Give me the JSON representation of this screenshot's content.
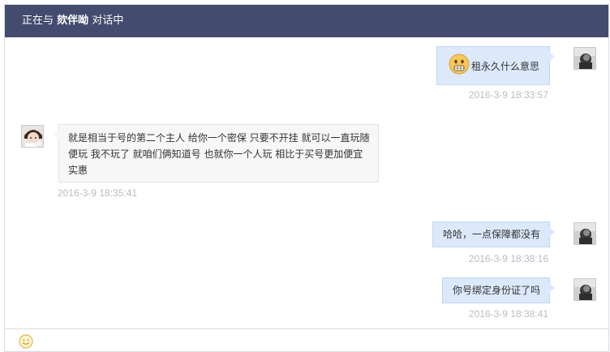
{
  "header": {
    "prefix": "正在与",
    "nickname": "欬伴呦",
    "suffix": "对话中"
  },
  "messages": [
    {
      "side": "right",
      "text": "租永久什么意思",
      "time": "2016-3-9 18:33:57",
      "has_emoji": true,
      "emoji": "grimace-emoji-icon"
    },
    {
      "side": "left",
      "text": "就是相当于号的第二个主人 给你一个密保 只要不开挂 就可以一直玩随便玩 我不玩了 就咱们俩知道号 也就你一个人玩 相比于买号更加便宜实惠",
      "time": "2016-3-9 18:35:41"
    },
    {
      "side": "right",
      "text": "哈哈，一点保障都没有",
      "time": "2016-3-9 18:38:16"
    },
    {
      "side": "right",
      "text": "你号绑定身份证了吗",
      "time": "2016-3-9 18:38:41"
    }
  ],
  "footer": {
    "emoji_button": "smiley-icon"
  },
  "colors": {
    "header_bg": "#434b6e",
    "bubble_right": "#dbe9fb",
    "bubble_left": "#f7f7f7",
    "timestamp": "#b8bcc4"
  }
}
